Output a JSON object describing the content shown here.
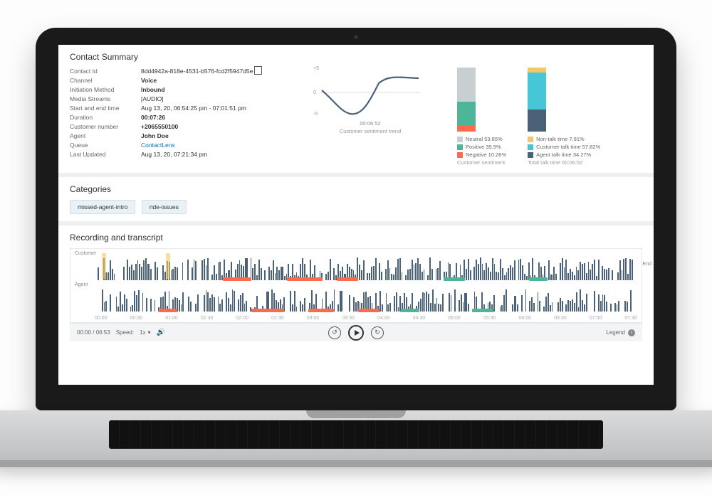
{
  "summary": {
    "title": "Contact Summary",
    "rows": {
      "contact_id": {
        "label": "Contact Id",
        "value": "8dd4942a-818e-4531-b576-fcd2f5947d5e"
      },
      "channel": {
        "label": "Channel",
        "value": "Voice"
      },
      "initiation": {
        "label": "Initiation Method",
        "value": "Inbound"
      },
      "media": {
        "label": "Media Streams",
        "value": "[AUDIO]"
      },
      "time": {
        "label": "Start and end time",
        "value": "Aug 13, 20, 06:54:25 pm - 07:01:51 pm"
      },
      "duration": {
        "label": "Duration",
        "value": "00:07:26"
      },
      "customer_number": {
        "label": "Customer number",
        "value": "+2065550100"
      },
      "agent": {
        "label": "Agent",
        "value": "John Doe"
      },
      "queue": {
        "label": "Queue",
        "value": "ContactLens"
      },
      "updated": {
        "label": "Last Updated",
        "value": "Aug 13, 20, 07:21:34 pm"
      }
    }
  },
  "chart_data": {
    "sentiment_trend": {
      "type": "line",
      "title": "Customer sentiment trend",
      "xlabel_value": "00:06:52",
      "ylim": [
        -5,
        5
      ],
      "yticks": [
        -5,
        0,
        5
      ],
      "x": [
        0,
        0.12,
        0.25,
        0.38,
        0.5,
        0.62,
        0.75,
        0.88,
        1.0
      ],
      "y": [
        0.5,
        -1.5,
        -3.8,
        -4.3,
        -2.5,
        1.5,
        3.2,
        2.8,
        2.9
      ]
    },
    "sentiment_breakdown": {
      "type": "stacked_bar",
      "title": "Customer sentiment",
      "segments": [
        {
          "name": "Negative",
          "value": 10.26,
          "color": "#ff6a4d"
        },
        {
          "name": "Positive",
          "value": 35.9,
          "color": "#4fb59a"
        },
        {
          "name": "Neutral",
          "value": 53.85,
          "color": "#c9ced1"
        }
      ]
    },
    "talk_time": {
      "type": "stacked_bar",
      "title": "Total talk time 00:06:52",
      "segments": [
        {
          "name": "Agent talk time",
          "value": 34.27,
          "color": "#4a6178"
        },
        {
          "name": "Customer talk time",
          "value": 57.82,
          "color": "#45c7d8"
        },
        {
          "name": "Non-talk time",
          "value": 7.91,
          "color": "#f3c968"
        }
      ]
    }
  },
  "legends": {
    "sentiment": [
      {
        "label": "Neutral 53.85%",
        "color": "#c9ced1"
      },
      {
        "label": "Positive 35.9%",
        "color": "#4fb59a"
      },
      {
        "label": "Negative 10.26%",
        "color": "#ff6a4d"
      }
    ],
    "sentiment_caption": "Customer sentiment",
    "talk": [
      {
        "label": "Non-talk time 7.91%",
        "color": "#f3c968"
      },
      {
        "label": "Customer talk time 57.82%",
        "color": "#45c7d8"
      },
      {
        "label": "Agent talk time 34.27%",
        "color": "#4a6178"
      }
    ],
    "talk_caption": "Total talk time 00:06:52"
  },
  "categories": {
    "title": "Categories",
    "items": [
      "missed-agent-intro",
      "ride-issues"
    ]
  },
  "recording": {
    "title": "Recording and transcript",
    "track_customer": "Customer",
    "track_agent": "Agent",
    "end_label": "End",
    "timeline": [
      "00:00",
      "00:30",
      "01:00",
      "01:30",
      "02:00",
      "02:30",
      "03:00",
      "03:30",
      "04:00",
      "04:30",
      "05:00",
      "05:30",
      "06:00",
      "06:30",
      "07:00",
      "07:30"
    ]
  },
  "player": {
    "position": "00:00 / 06:53",
    "speed_label": "Speed:",
    "speed_value": "1x",
    "legend_label": "Legend"
  }
}
